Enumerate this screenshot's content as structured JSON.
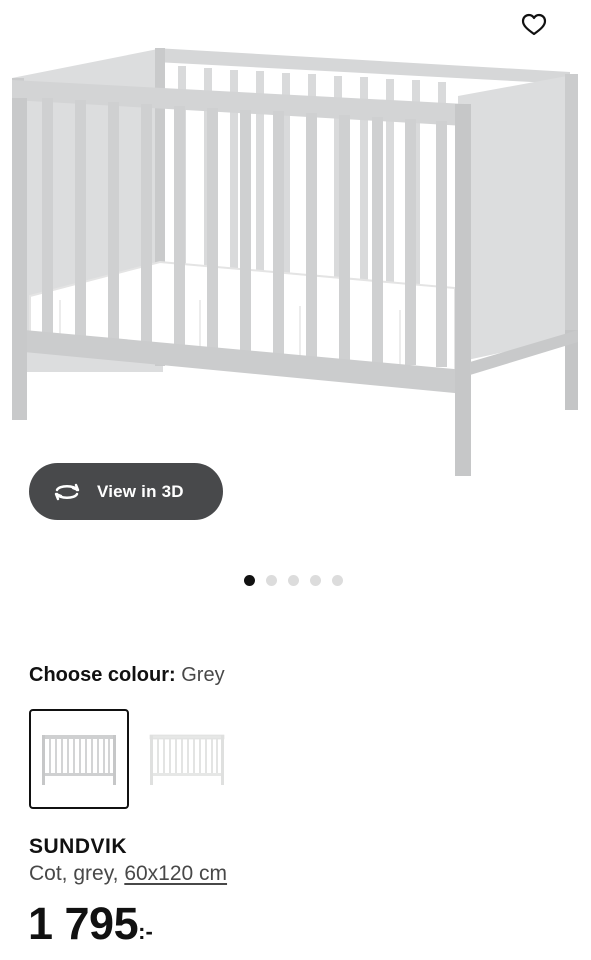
{
  "header": {
    "favourite_icon": "heart-outline-icon"
  },
  "gallery": {
    "view_3d_label": "View in 3D",
    "view_3d_icon": "rotate-3d-icon",
    "dots_total": 5,
    "active_dot": 1
  },
  "colour": {
    "label": "Choose colour:",
    "selected": "Grey",
    "options": [
      "Grey",
      "White"
    ]
  },
  "product": {
    "name": "SUNDVIK",
    "desc_prefix": "Cot, grey, ",
    "size": "60x120 cm",
    "price_amount": "1 795",
    "price_suffix": ":-"
  },
  "colors": {
    "pill_bg": "#48494b",
    "crib_grey": "#cfd0d1",
    "crib_white": "#f2f3f2",
    "dot_active": "#111111",
    "dot_inactive": "#dcdcdc"
  }
}
